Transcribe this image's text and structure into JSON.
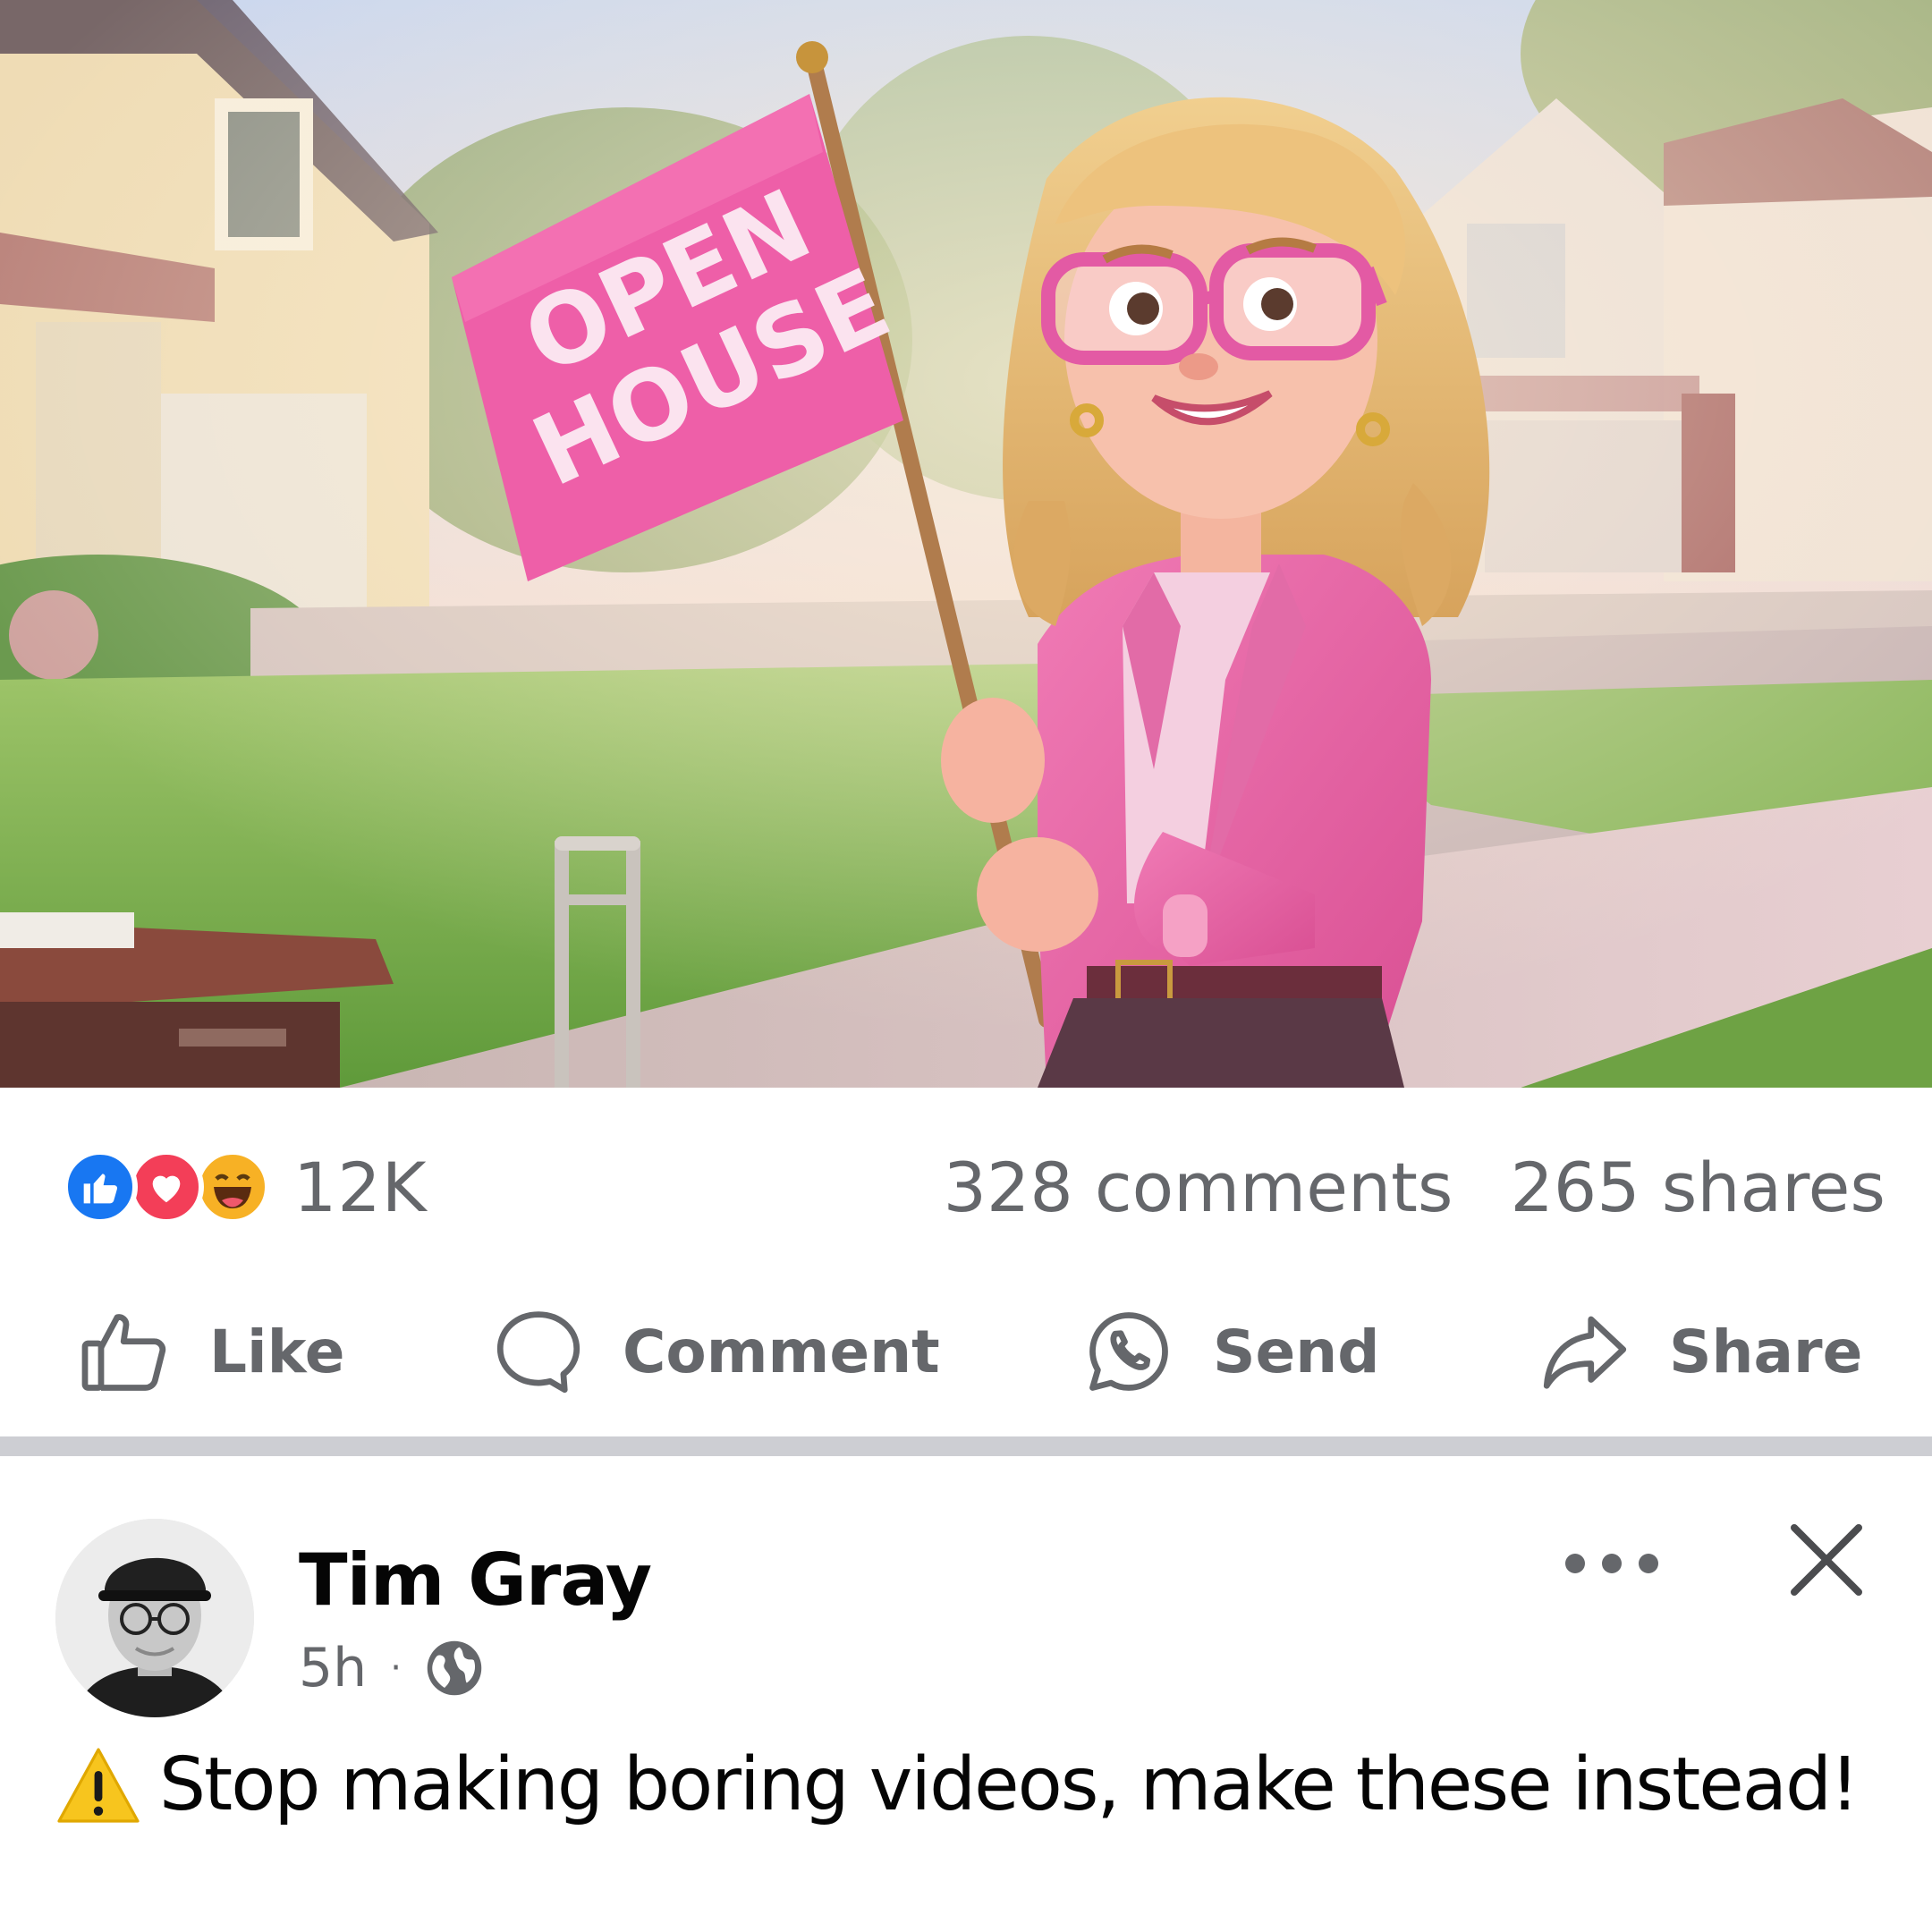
{
  "post": {
    "image_alt_text": "OPEN HOUSE",
    "reactions": {
      "icons": [
        "like-reaction-icon",
        "love-reaction-icon",
        "haha-reaction-icon"
      ],
      "count": "12K"
    },
    "comments": "328 comments",
    "shares": "265 shares"
  },
  "actions": {
    "like": "Like",
    "comment": "Comment",
    "send": "Send",
    "share": "Share"
  },
  "next_post": {
    "author": "Tim Gray",
    "time": "5h",
    "separator": "·",
    "privacy_icon": "globe-icon",
    "caption": "Stop making boring videos, make these instead!",
    "caption_icon": "warning-icon"
  },
  "colors": {
    "like_blue": "#1877f2",
    "love_red": "#f33e58",
    "haha_yellow": "#f7b125",
    "secondary_text": "#65676b",
    "flag_pink": "#ee5fa8",
    "divider": "#cdced3"
  }
}
